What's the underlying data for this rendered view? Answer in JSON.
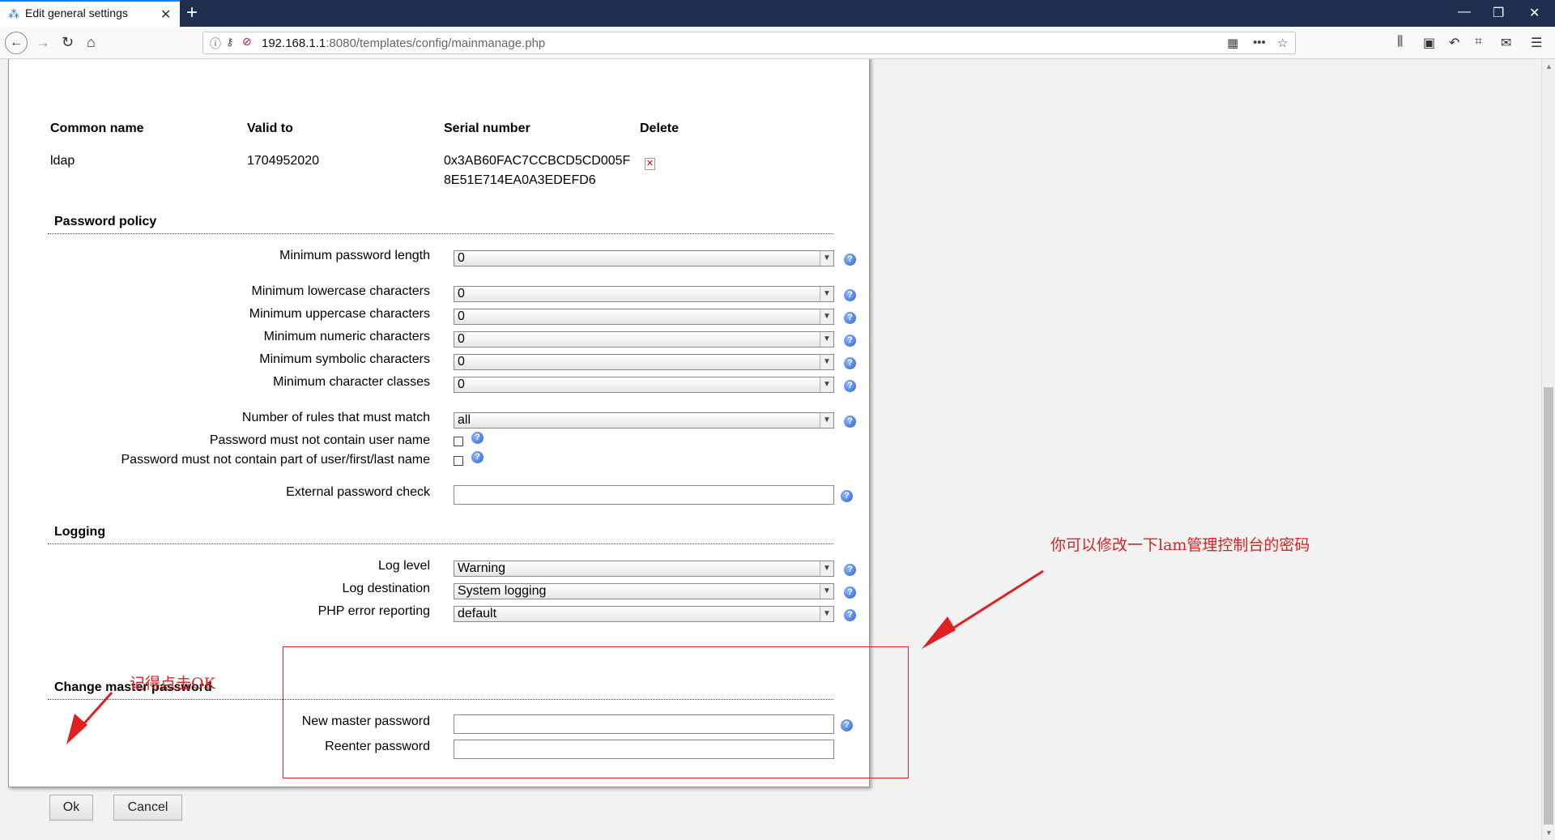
{
  "browser": {
    "tab_title": "Edit general settings",
    "tab_close": "✕",
    "new_tab": "+",
    "url_host": "192.168.1.1",
    "url_path": ":8080/templates/config/mainmanage.php"
  },
  "certificates": {
    "headers": [
      "Common name",
      "Valid to",
      "Serial number",
      "Delete"
    ],
    "row": {
      "common_name": "ldap",
      "valid_to": "1704952020",
      "serial_line1": "0x3AB60FAC7CCBCD5CD005F",
      "serial_line2": "8E51E714EA0A3EDEFD6"
    }
  },
  "password_policy": {
    "title": "Password policy",
    "min_length_label": "Minimum password length",
    "min_length_value": "0",
    "min_lower_label": "Minimum lowercase characters",
    "min_lower_value": "0",
    "min_upper_label": "Minimum uppercase characters",
    "min_upper_value": "0",
    "min_numeric_label": "Minimum numeric characters",
    "min_numeric_value": "0",
    "min_symbolic_label": "Minimum symbolic characters",
    "min_symbolic_value": "0",
    "min_classes_label": "Minimum character classes",
    "min_classes_value": "0",
    "rules_match_label": "Number of rules that must match",
    "rules_match_value": "all",
    "no_username_label": "Password must not contain user name",
    "no_name_parts_label": "Password must not contain part of user/first/last name",
    "external_check_label": "External password check",
    "external_check_value": ""
  },
  "logging": {
    "title": "Logging",
    "level_label": "Log level",
    "level_value": "Warning",
    "destination_label": "Log destination",
    "destination_value": "System logging",
    "php_error_label": "PHP error reporting",
    "php_error_value": "default"
  },
  "master_password": {
    "title": "Change master password",
    "new_label": "New master password",
    "reenter_label": "Reenter password"
  },
  "buttons": {
    "ok": "Ok",
    "cancel": "Cancel"
  },
  "annotations": {
    "right_note": "你可以修改一下lam管理控制台的密码",
    "left_note": "记得点击OK",
    "color": "#e02020"
  }
}
